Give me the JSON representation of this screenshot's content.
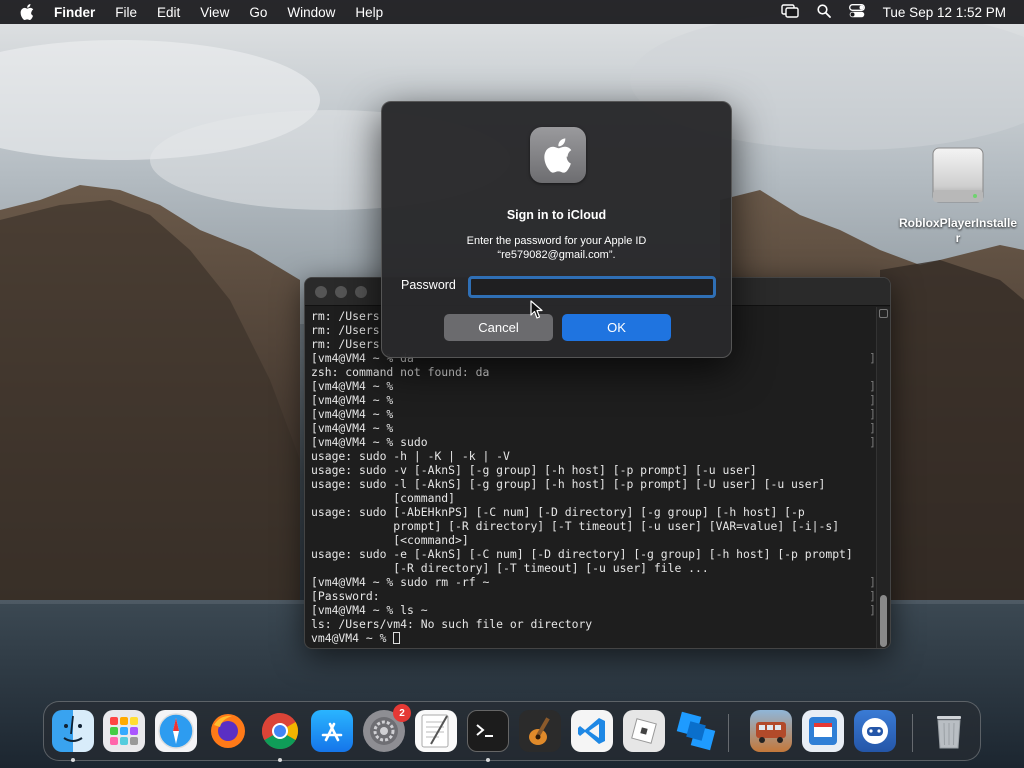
{
  "menubar": {
    "app_name": "Finder",
    "items": [
      "File",
      "Edit",
      "View",
      "Go",
      "Window",
      "Help"
    ],
    "clock": "Tue Sep 12  1:52 PM"
  },
  "desktop": {
    "icon_label": "RobloxPlayerInstaller"
  },
  "terminal": {
    "lines": [
      {
        "text": "rm: /Users",
        "mark": ""
      },
      {
        "text": "rm: /Users",
        "mark": ""
      },
      {
        "text": "rm: /Users",
        "mark": ""
      },
      {
        "text": "[vm4@VM4 ~ % da",
        "mark": "]"
      },
      {
        "text": "zsh: command not found: da",
        "mark": ""
      },
      {
        "text": "[vm4@VM4 ~ %",
        "mark": "]"
      },
      {
        "text": "[vm4@VM4 ~ %",
        "mark": "]"
      },
      {
        "text": "[vm4@VM4 ~ %",
        "mark": "]"
      },
      {
        "text": "[vm4@VM4 ~ %",
        "mark": "]"
      },
      {
        "text": "[vm4@VM4 ~ % sudo",
        "mark": "]"
      },
      {
        "text": "usage: sudo -h | -K | -k | -V",
        "mark": ""
      },
      {
        "text": "usage: sudo -v [-AknS] [-g group] [-h host] [-p prompt] [-u user]",
        "mark": ""
      },
      {
        "text": "usage: sudo -l [-AknS] [-g group] [-h host] [-p prompt] [-U user] [-u user]",
        "mark": ""
      },
      {
        "text": "            [command]",
        "mark": ""
      },
      {
        "text": "usage: sudo [-AbEHknPS] [-C num] [-D directory] [-g group] [-h host] [-p",
        "mark": ""
      },
      {
        "text": "            prompt] [-R directory] [-T timeout] [-u user] [VAR=value] [-i|-s]",
        "mark": ""
      },
      {
        "text": "            [<command>]",
        "mark": ""
      },
      {
        "text": "usage: sudo -e [-AknS] [-C num] [-D directory] [-g group] [-h host] [-p prompt]",
        "mark": ""
      },
      {
        "text": "            [-R directory] [-T timeout] [-u user] file ...",
        "mark": ""
      },
      {
        "text": "[vm4@VM4 ~ % sudo rm -rf ~",
        "mark": "]"
      },
      {
        "text": "[Password:",
        "mark": "]"
      },
      {
        "text": "[vm4@VM4 ~ % ls ~",
        "mark": "]"
      },
      {
        "text": "ls: /Users/vm4: No such file or directory",
        "mark": ""
      },
      {
        "text": "vm4@VM4 ~ % ",
        "mark": ""
      }
    ]
  },
  "dialog": {
    "title": "Sign in to iCloud",
    "message_line1": "Enter the password for your Apple ID",
    "message_line2": "“re579082@gmail.com”.",
    "password_label": "Password",
    "password_value": "",
    "cancel_label": "Cancel",
    "ok_label": "OK"
  },
  "dock": {
    "settings_badge": "2"
  },
  "colors": {
    "accent": "#1f74e0",
    "focus_ring": "#2f6fb5",
    "badge": "#e53935"
  }
}
